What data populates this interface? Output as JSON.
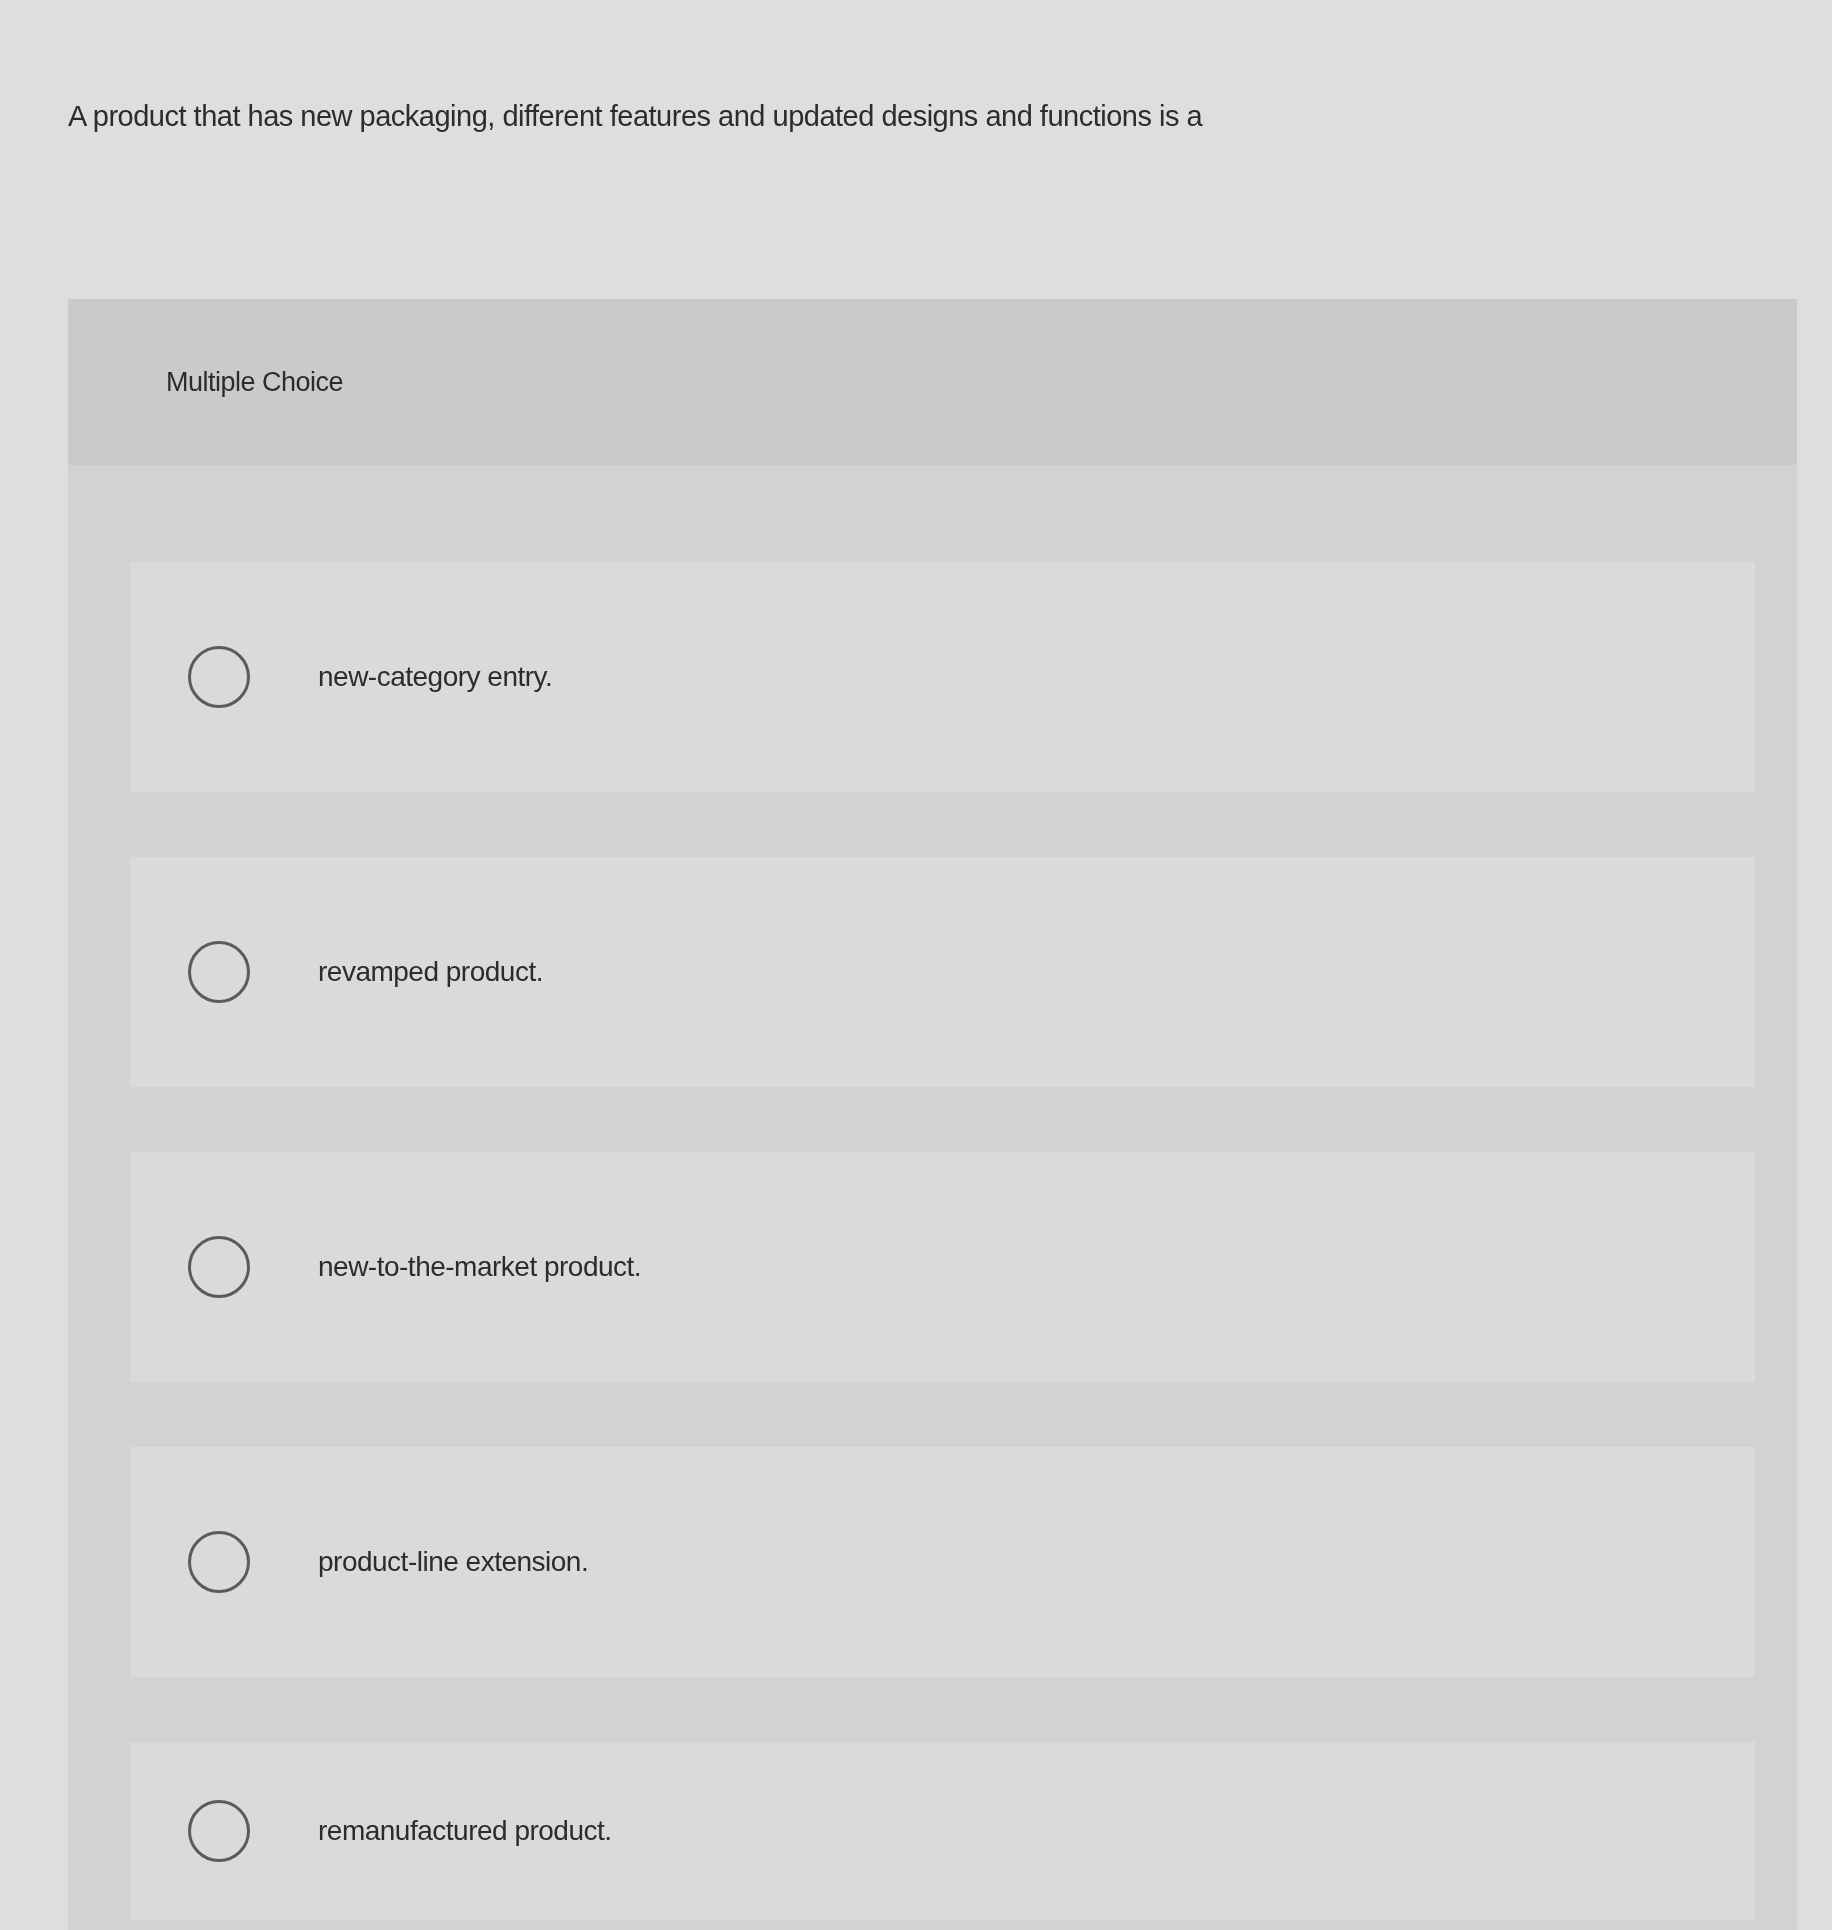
{
  "question": "A product that has new packaging, different features and updated designs and functions is a",
  "panel": {
    "title": "Multiple Choice"
  },
  "options": [
    {
      "label": "new-category entry.",
      "selected": false
    },
    {
      "label": "revamped product.",
      "selected": false
    },
    {
      "label": "new-to-the-market product.",
      "selected": false
    },
    {
      "label": "product-line extension.",
      "selected": false
    },
    {
      "label": "remanufactured product.",
      "selected": false
    }
  ]
}
